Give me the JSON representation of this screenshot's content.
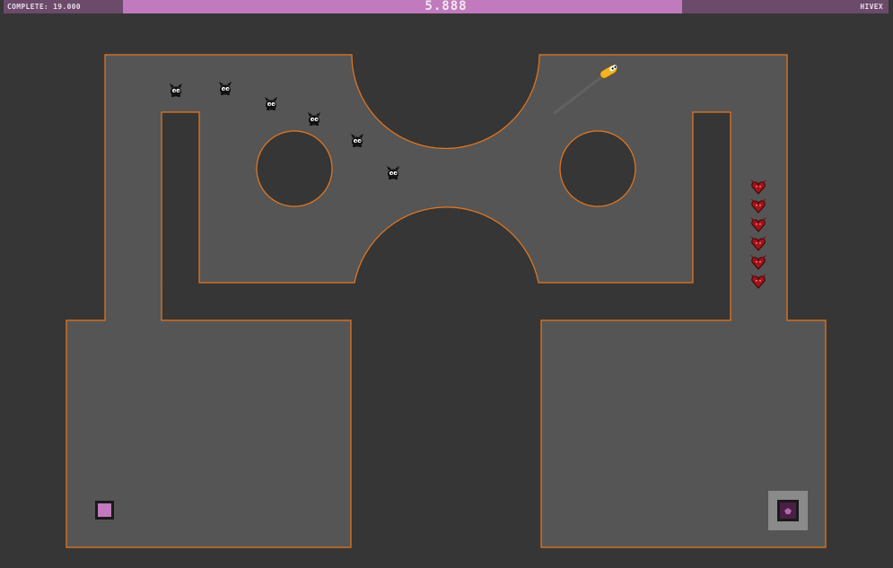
{
  "hud": {
    "complete_label": "COMPLETE: 19.000",
    "timer": "5.888",
    "player_name": "HIVEX",
    "timer_progress": 0.73
  },
  "colors": {
    "background": "#363636",
    "floor": "#555555",
    "outline": "#e8781e",
    "hud_bar": "#6b4a6a",
    "hud_fill": "#c07abd",
    "player": "#f0b429",
    "enemy_black": "#111111",
    "enemy_red": "#a0141a",
    "start_pad": "#c07abd",
    "exit_pad": "#4a1f45"
  },
  "entities": {
    "player": {
      "icon": "yellow-capsule-player-icon"
    },
    "black_creatures": {
      "icon": "black-creature-icon",
      "count": 6
    },
    "red_creatures": {
      "icon": "red-heart-creature-icon",
      "count": 6
    },
    "start_pad": {
      "icon": "pink-square-pad-icon"
    },
    "exit_pad": {
      "icon": "exit-portal-icon"
    }
  }
}
